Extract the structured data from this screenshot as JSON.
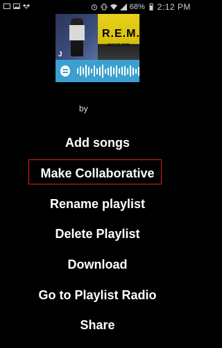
{
  "status_bar": {
    "battery_percent": "68%",
    "time": "2:12 PM",
    "icons_left": [
      "cast-icon",
      "image-icon",
      "dropbox-icon"
    ],
    "icons_right": [
      "alarm-icon",
      "vibrate-icon",
      "wifi-icon",
      "signal-icon",
      "battery-icon"
    ]
  },
  "playlist": {
    "by_label": "by",
    "art_left_text": "J",
    "art_right_text": "R.E.M.",
    "art_right_sub": "OUT OF TIME"
  },
  "menu": {
    "items": [
      {
        "label": "Add songs"
      },
      {
        "label": "Make Collaborative"
      },
      {
        "label": "Rename playlist"
      },
      {
        "label": "Delete Playlist"
      },
      {
        "label": "Download"
      },
      {
        "label": "Go to Playlist Radio"
      },
      {
        "label": "Share"
      }
    ]
  }
}
